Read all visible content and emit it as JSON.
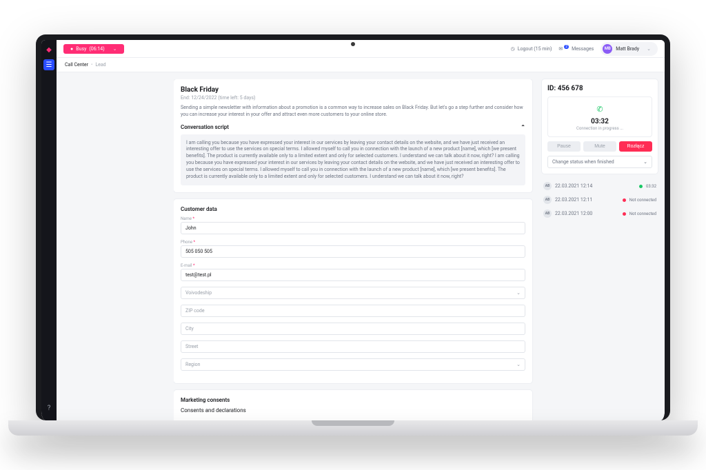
{
  "status": {
    "label": "Busy",
    "time": "(06:14)",
    "dot": "●"
  },
  "topbar": {
    "logout": "Logout (15 min)",
    "messages": "Messages",
    "messages_badge": "2",
    "user_initials": "MB",
    "user_name": "Matt Brady"
  },
  "crumbs": {
    "root": "Call Center",
    "leaf": "Lead"
  },
  "campaign": {
    "title": "Black Friday",
    "subtitle": "End: 12/24/2022 (time left: 5 days)",
    "body": "Sending a simple newsletter with information about a promotion is a common way to increase sales on Black Friday. But let's go a step further and consider how you can increase your interest in your offer and attract even more customers to your online store.",
    "script_head": "Conversation script",
    "script_text": "I am calling you because you have expressed your interest in our services by leaving your contact details on the website, and we have just received an interesting offer to use the services on special terms. I allowed myself to call you in connection with the launch of a new product [name], which [we present benefits]. The product is currently available only to a limited extent and only for selected customers. I understand we can talk about it now, right? I am calling you because you have expressed your interest in our services by leaving your contact details on the website, and we have just received an interesting offer to use the services on special terms. I allowed myself to call you in connection with the launch of a new product [name], which [we present benefits]. The product is currently available only to a limited extent and only for selected customers. I understand we can talk about it now, right?"
  },
  "customer": {
    "heading": "Customer data",
    "labels": {
      "name": "Name",
      "phone": "Phone",
      "email": "E-mail",
      "voivodeship": "Voivodeship",
      "zip": "ZIP code",
      "city": "City",
      "street": "Street",
      "region": "Region"
    },
    "values": {
      "name": "John",
      "phone": "505 050 505",
      "email": "test@test.pl"
    }
  },
  "consents": {
    "heading": "Marketing consents",
    "sub": "Consents and declarations"
  },
  "call": {
    "id_label": "ID: 456 678",
    "timer": "03:32",
    "status": "Connection in progress ...",
    "pause": "Pause",
    "mute": "Mute",
    "end": "Rozłącz",
    "change_status": "Change status when finished"
  },
  "log": [
    {
      "initials": "AB",
      "date": "22.03.2021 12:14",
      "status": "03:32",
      "ok": true
    },
    {
      "initials": "AB",
      "date": "22.03.2021 12:11",
      "status": "Not connected",
      "ok": false
    },
    {
      "initials": "AB",
      "date": "22.03.2021 12:00",
      "status": "Not connected",
      "ok": false
    }
  ]
}
